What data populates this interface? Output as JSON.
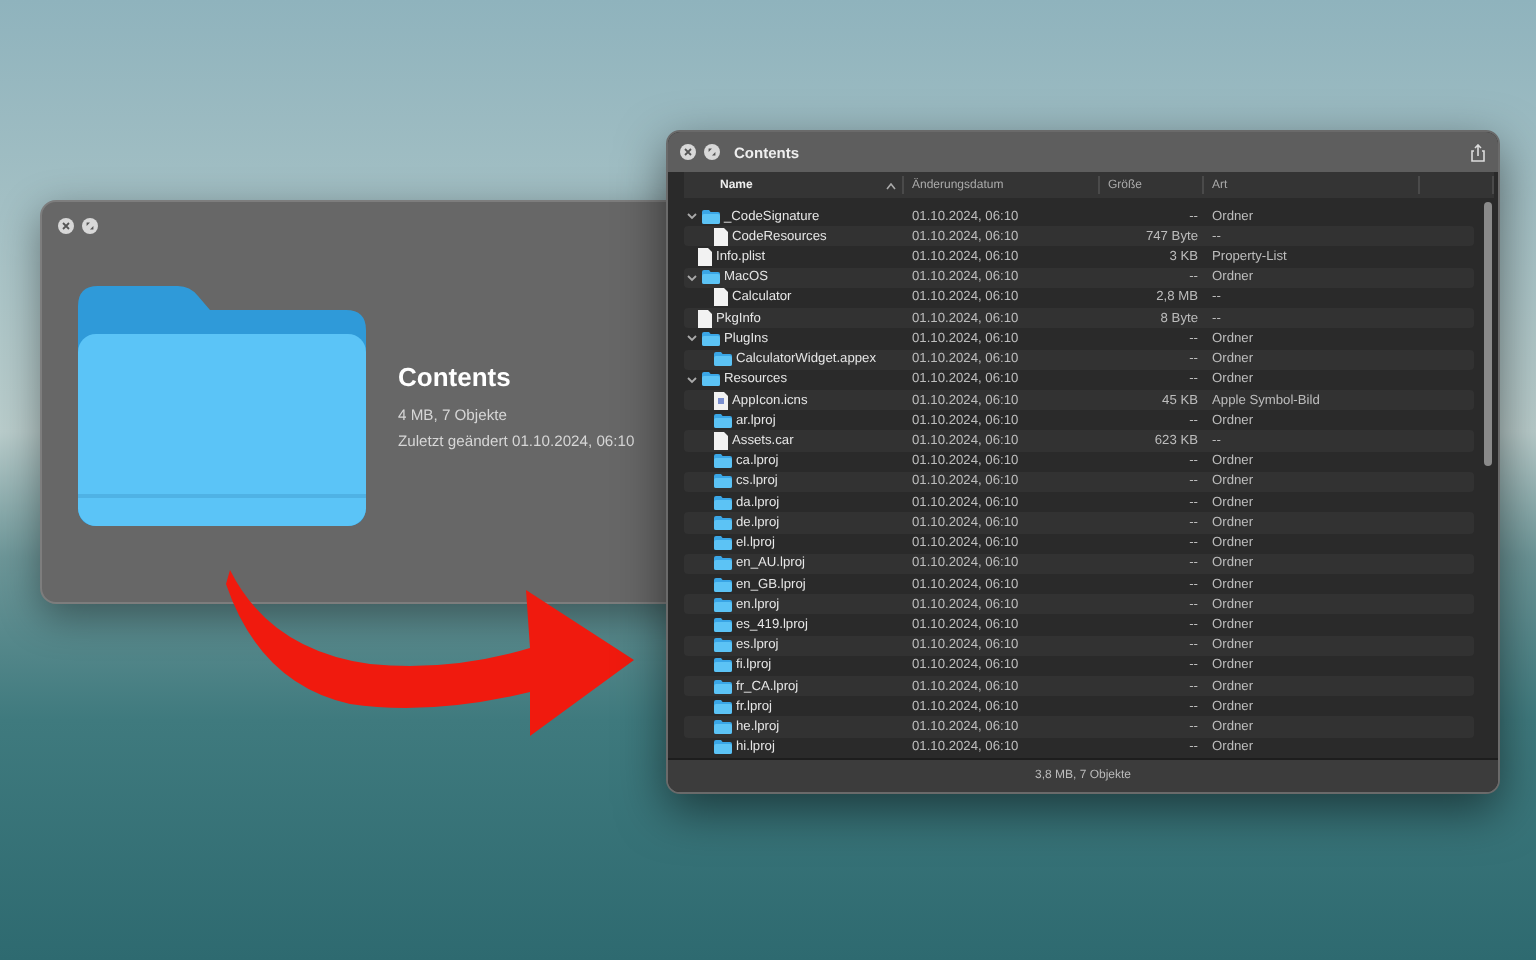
{
  "quicklook": {
    "title": "Contents",
    "info": "4 MB, 7 Objekte",
    "modified": "Zuletzt geändert 01.10.2024, 06:10"
  },
  "finder": {
    "title": "Contents",
    "columns": [
      {
        "label": "Name",
        "sorted": true
      },
      {
        "label": "Änderungsdatum",
        "sorted": false
      },
      {
        "label": "Größe",
        "sorted": false
      },
      {
        "label": "Art",
        "sorted": false
      }
    ],
    "rows": [
      {
        "name": "_CodeSignature",
        "kind": "folder",
        "date": "01.10.2024, 06:10",
        "size": "--",
        "type": "Ordner",
        "expanded": true,
        "children": [
          {
            "name": "CodeResources",
            "kind": "file",
            "date": "01.10.2024, 06:10",
            "size": "747 Byte",
            "type": "--"
          }
        ]
      },
      {
        "name": "Info.plist",
        "kind": "file",
        "date": "01.10.2024, 06:10",
        "size": "3 KB",
        "type": "Property-List"
      },
      {
        "name": "MacOS",
        "kind": "folder",
        "date": "01.10.2024, 06:10",
        "size": "--",
        "type": "Ordner",
        "expanded": true,
        "children": [
          {
            "name": "Calculator",
            "kind": "file",
            "date": "01.10.2024, 06:10",
            "size": "2,8 MB",
            "type": "--"
          }
        ]
      },
      {
        "name": "PkgInfo",
        "kind": "file",
        "date": "01.10.2024, 06:10",
        "size": "8 Byte",
        "type": "--"
      },
      {
        "name": "PlugIns",
        "kind": "folder",
        "date": "01.10.2024, 06:10",
        "size": "--",
        "type": "Ordner",
        "expanded": true,
        "children": [
          {
            "name": "CalculatorWidget.appex",
            "kind": "folder",
            "date": "01.10.2024, 06:10",
            "size": "--",
            "type": "Ordner"
          }
        ]
      },
      {
        "name": "Resources",
        "kind": "folder",
        "date": "01.10.2024, 06:10",
        "size": "--",
        "type": "Ordner",
        "expanded": true,
        "children": [
          {
            "name": "AppIcon.icns",
            "kind": "image",
            "date": "01.10.2024, 06:10",
            "size": "45 KB",
            "type": "Apple Symbol-Bild"
          },
          {
            "name": "ar.lproj",
            "kind": "folder",
            "date": "01.10.2024, 06:10",
            "size": "--",
            "type": "Ordner"
          },
          {
            "name": "Assets.car",
            "kind": "file",
            "date": "01.10.2024, 06:10",
            "size": "623 KB",
            "type": "--"
          },
          {
            "name": "ca.lproj",
            "kind": "folder",
            "date": "01.10.2024, 06:10",
            "size": "--",
            "type": "Ordner"
          },
          {
            "name": "cs.lproj",
            "kind": "folder",
            "date": "01.10.2024, 06:10",
            "size": "--",
            "type": "Ordner"
          },
          {
            "name": "da.lproj",
            "kind": "folder",
            "date": "01.10.2024, 06:10",
            "size": "--",
            "type": "Ordner"
          },
          {
            "name": "de.lproj",
            "kind": "folder",
            "date": "01.10.2024, 06:10",
            "size": "--",
            "type": "Ordner"
          },
          {
            "name": "el.lproj",
            "kind": "folder",
            "date": "01.10.2024, 06:10",
            "size": "--",
            "type": "Ordner"
          },
          {
            "name": "en_AU.lproj",
            "kind": "folder",
            "date": "01.10.2024, 06:10",
            "size": "--",
            "type": "Ordner"
          },
          {
            "name": "en_GB.lproj",
            "kind": "folder",
            "date": "01.10.2024, 06:10",
            "size": "--",
            "type": "Ordner"
          },
          {
            "name": "en.lproj",
            "kind": "folder",
            "date": "01.10.2024, 06:10",
            "size": "--",
            "type": "Ordner"
          },
          {
            "name": "es_419.lproj",
            "kind": "folder",
            "date": "01.10.2024, 06:10",
            "size": "--",
            "type": "Ordner"
          },
          {
            "name": "es.lproj",
            "kind": "folder",
            "date": "01.10.2024, 06:10",
            "size": "--",
            "type": "Ordner"
          },
          {
            "name": "fi.lproj",
            "kind": "folder",
            "date": "01.10.2024, 06:10",
            "size": "--",
            "type": "Ordner"
          },
          {
            "name": "fr_CA.lproj",
            "kind": "folder",
            "date": "01.10.2024, 06:10",
            "size": "--",
            "type": "Ordner"
          },
          {
            "name": "fr.lproj",
            "kind": "folder",
            "date": "01.10.2024, 06:10",
            "size": "--",
            "type": "Ordner"
          },
          {
            "name": "he.lproj",
            "kind": "folder",
            "date": "01.10.2024, 06:10",
            "size": "--",
            "type": "Ordner"
          },
          {
            "name": "hi.lproj",
            "kind": "folder",
            "date": "01.10.2024, 06:10",
            "size": "--",
            "type": "Ordner"
          }
        ]
      }
    ],
    "status": "3,8 MB, 7 Objekte"
  }
}
